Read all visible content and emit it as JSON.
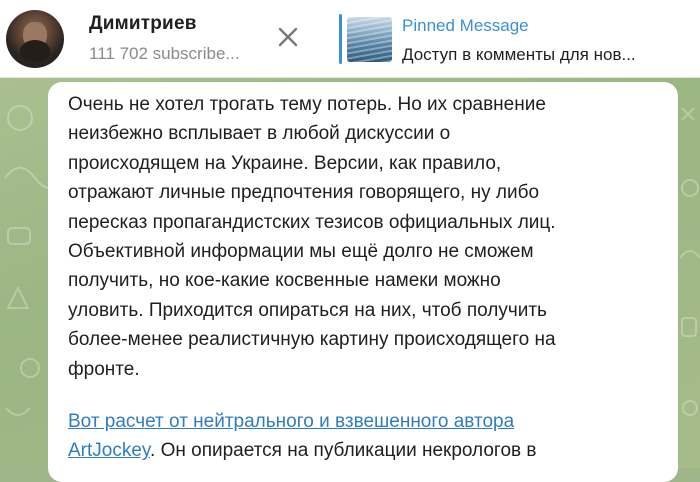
{
  "header": {
    "channel_name": "Димитриев",
    "subscribers": "111 702 subscribe...",
    "close_icon": "close-icon"
  },
  "pinned": {
    "title": "Pinned Message",
    "preview": "Доступ в комменты для нов..."
  },
  "message": {
    "paragraph1": "Очень не хотел трогать тему потерь. Но их сравнение\nнеизбежно всплывает в любой дискуссии о\nпроисходящем на Украине. Версии, как правило,\nотражают личные предпочтения  говорящего, ну либо\nпересказ пропагандистских тезисов официальных лиц.\nОбъективной информации мы ещё долго не сможем\nполучить, но кое-какие косвенные намеки можно\nуловить. Приходится опираться на них, чтоб получить\nболее-менее реалистичную картину происходящего на\nфронте.",
    "link_part1": "Вот расчет от нейтрального и взвешенного автора",
    "link_part2": "ArtJockey",
    "paragraph2_rest": ". Он опирается на публикации некрологов в"
  }
}
